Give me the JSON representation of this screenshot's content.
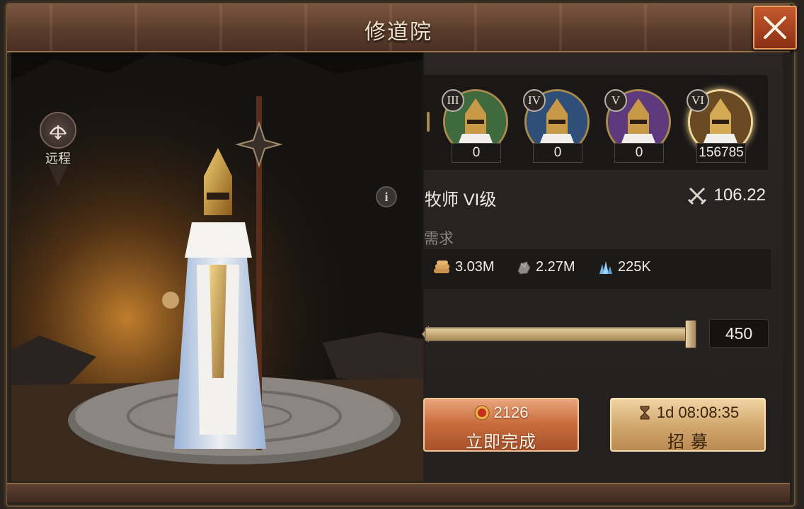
{
  "window": {
    "title": "修道院"
  },
  "unit_type": {
    "label": "远程",
    "icon": "bow-icon"
  },
  "tiers": [
    {
      "numeral": "III",
      "count": "0",
      "color": "#3f6a3e"
    },
    {
      "numeral": "IV",
      "count": "0",
      "color": "#2f4e78"
    },
    {
      "numeral": "V",
      "count": "0",
      "color": "#5e3a7c"
    },
    {
      "numeral": "VI",
      "count": "156785",
      "color": "#6a4a22"
    }
  ],
  "unit": {
    "name": "牧师 VI级",
    "power": "106.22"
  },
  "requirements": {
    "label": "需求",
    "wood": "3.03M",
    "ore": "2.27M",
    "crystal": "225K"
  },
  "slider": {
    "quantity": "450",
    "fill_fraction": 1.0
  },
  "buttons": {
    "instant_cost": "2126",
    "instant_label": "立即完成",
    "recruit_time": "1d 08:08:35",
    "recruit_label": "招 募"
  }
}
